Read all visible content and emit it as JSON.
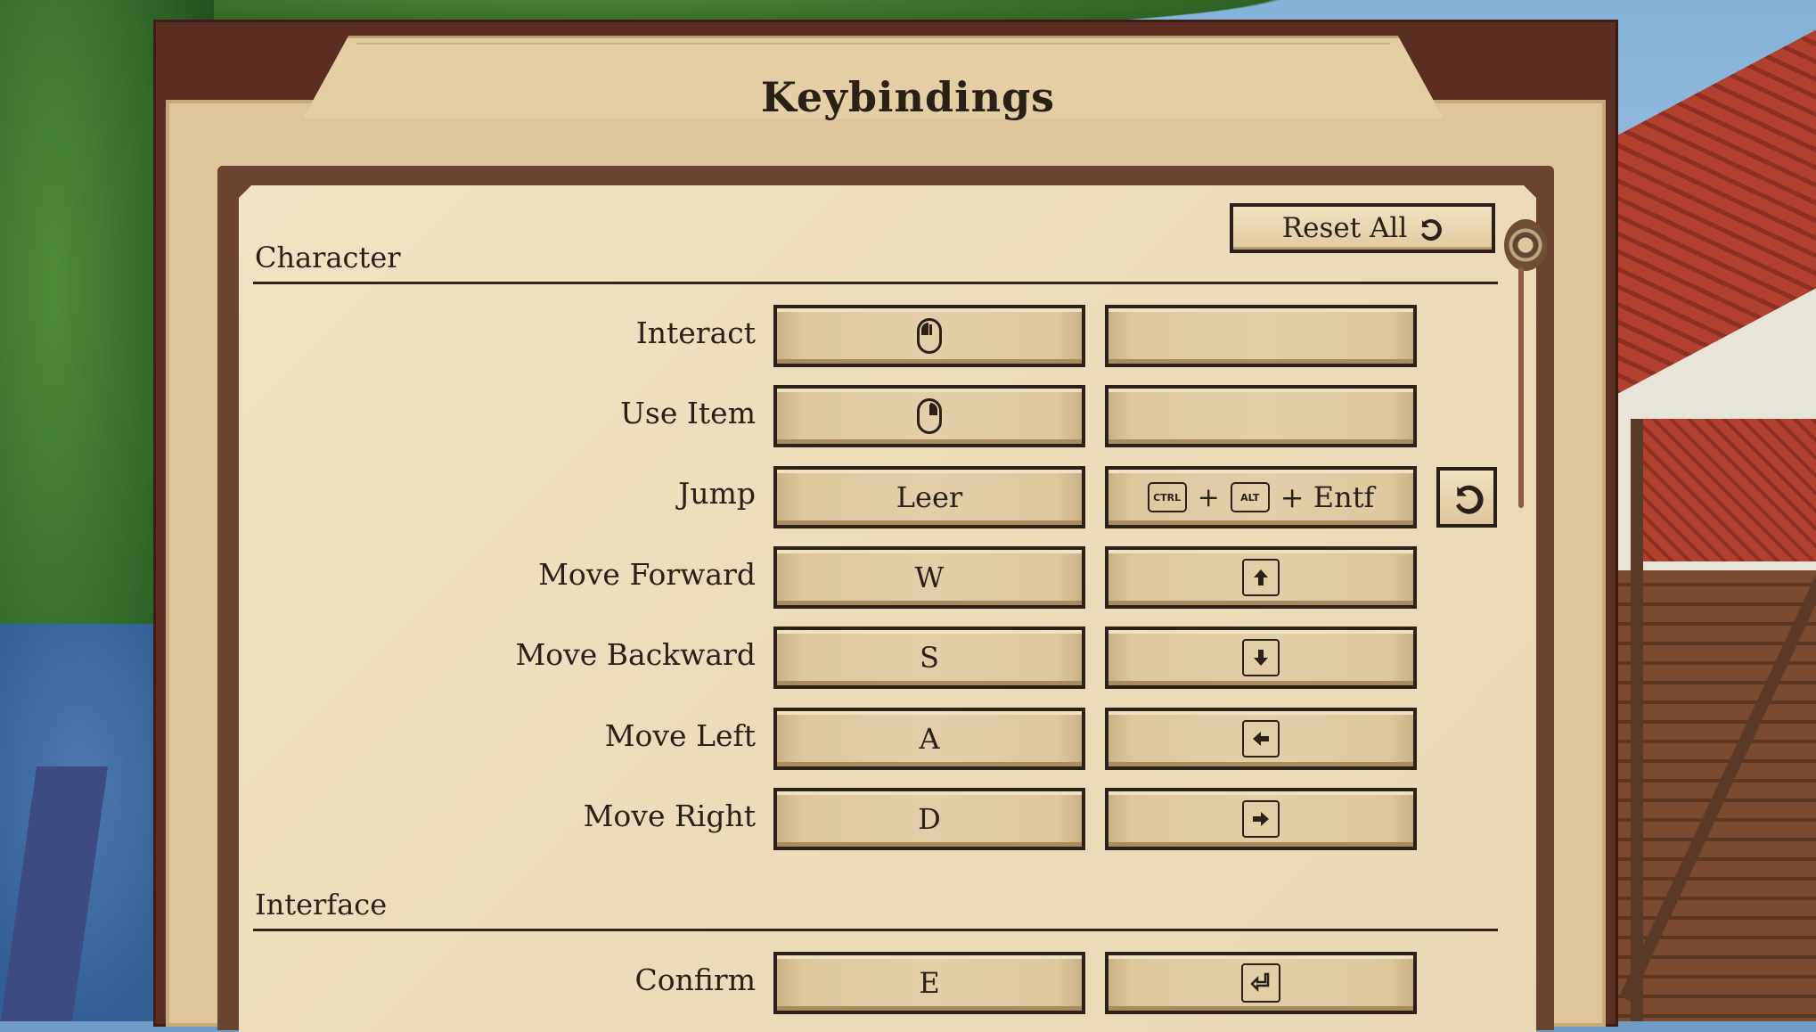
{
  "title": "Keybindings",
  "reset_all_label": "Reset All",
  "sections": {
    "character": {
      "title": "Character",
      "rows": [
        {
          "label": "Interact",
          "primary": "mouse-left-click-icon",
          "secondary": ""
        },
        {
          "label": "Use Item",
          "primary": "mouse-right-click-icon",
          "secondary": ""
        },
        {
          "label": "Jump",
          "primary": "Leer",
          "secondary_parts": [
            "CTRL",
            "+",
            "ALT",
            "+ Entf"
          ]
        },
        {
          "label": "Move Forward",
          "primary": "W",
          "secondary": "arrow-up-key-icon"
        },
        {
          "label": "Move Backward",
          "primary": "S",
          "secondary": "arrow-down-key-icon"
        },
        {
          "label": "Move Left",
          "primary": "A",
          "secondary": "arrow-left-key-icon"
        },
        {
          "label": "Move Right",
          "primary": "D",
          "secondary": "arrow-right-key-icon"
        }
      ]
    },
    "interface": {
      "title": "Interface",
      "rows": [
        {
          "label": "Confirm",
          "primary": "E",
          "secondary": "enter-key-icon"
        }
      ]
    }
  },
  "colors": {
    "panel_frame": "#5b2e22",
    "parchment": "#ecdcbb",
    "ink": "#2a2016"
  }
}
